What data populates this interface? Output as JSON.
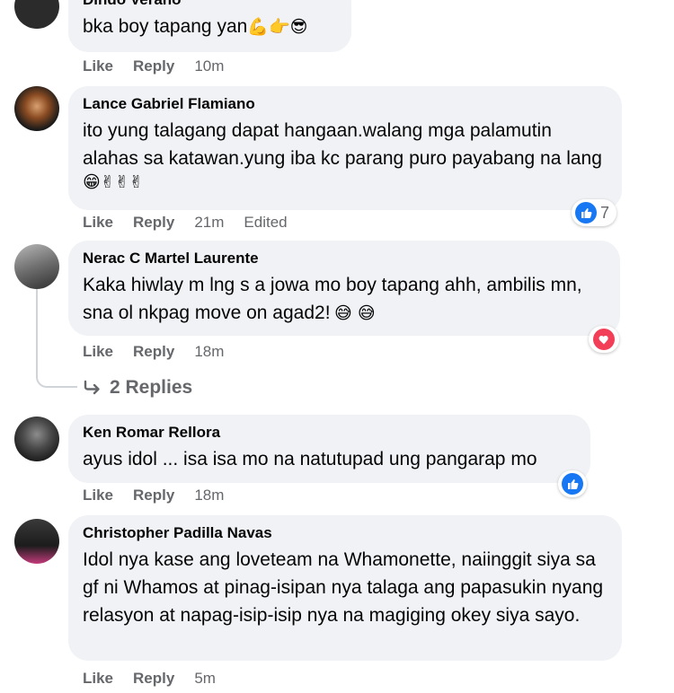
{
  "comments": [
    {
      "author": "Dindo Verano",
      "text": "bka boy tapang yan",
      "emoji": "💪👉😎",
      "like": "Like",
      "reply": "Reply",
      "time": "10m"
    },
    {
      "author": "Lance Gabriel Flamiano",
      "text": "ito yung talagang dapat hangaan.walang mga palamutin alahas sa katawan.yung iba kc parang puro payabang na lang",
      "emoji": "😁✌✌✌",
      "like": "Like",
      "reply": "Reply",
      "time": "21m",
      "edited": "Edited",
      "reaction_count": "7"
    },
    {
      "author": "Nerac C Martel Laurente",
      "text": "Kaka hiwlay m lng s a jowa mo boy tapang ahh, ambilis mn, sna ol nkpag move on agad2!",
      "emoji": "😅 😅",
      "like": "Like",
      "reply": "Reply",
      "time": "18m",
      "replies": "2 Replies"
    },
    {
      "author": "Ken Romar Rellora",
      "text": "ayus idol ... isa isa mo na natutupad ung pangarap mo",
      "like": "Like",
      "reply": "Reply",
      "time": "18m"
    },
    {
      "author": "Christopher Padilla Navas",
      "text": "Idol nya kase ang loveteam na Whamonette, naiinggit siya sa gf ni Whamos at pinag-isipan nya talaga ang papasukin nyang relasyon at napag-isip-isip nya na magiging okey siya sayo.",
      "like": "Like",
      "reply": "Reply",
      "time": "5m"
    }
  ],
  "colors": {
    "bubble": "#f0f2f5",
    "meta_text": "#65676b",
    "like_blue": "#1877f2",
    "love_red": "#f33e58"
  }
}
